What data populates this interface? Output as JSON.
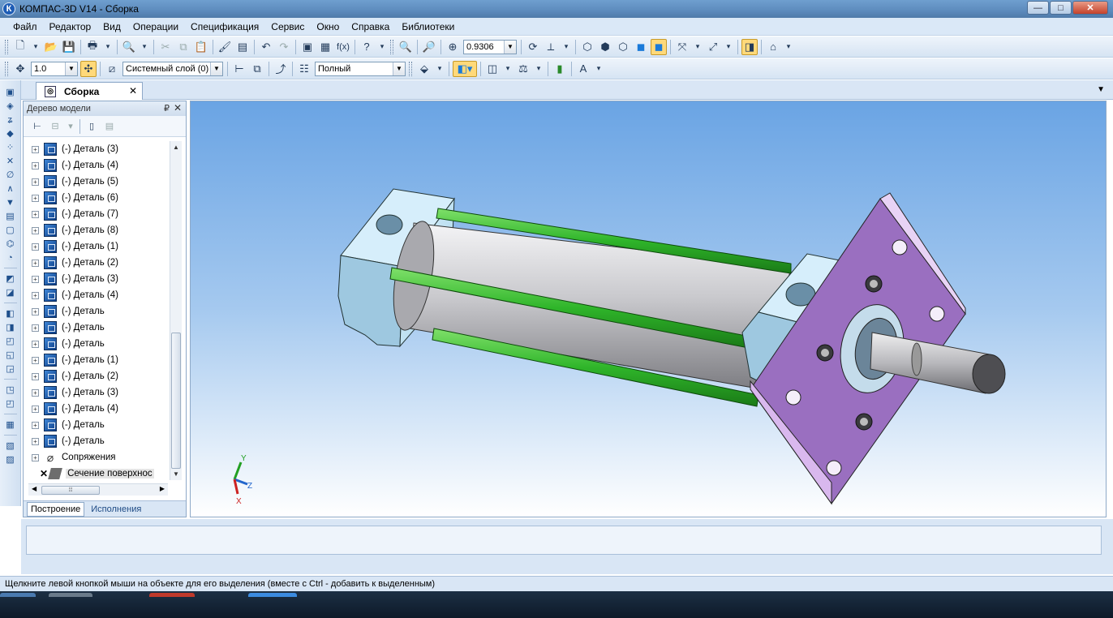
{
  "window": {
    "title": "КОМПАС-3D V14 - Сборка",
    "app_icon": "К",
    "controls": {
      "minimize": "—",
      "maximize": "□",
      "close": "✕"
    }
  },
  "menu": [
    "Файл",
    "Редактор",
    "Вид",
    "Операции",
    "Спецификация",
    "Сервис",
    "Окно",
    "Справка",
    "Библиотеки"
  ],
  "toolbar1": {
    "zoom_value": "0.9306"
  },
  "toolbar2": {
    "line_step": "1.0",
    "layer": "Системный слой (0)",
    "mode": "Полный"
  },
  "document_tab": {
    "label": "Сборка",
    "close": "✕"
  },
  "model_tree": {
    "header": "Дерево модели",
    "pin": "₽",
    "close": "✕",
    "items": [
      {
        "label": "(-) Деталь (3)",
        "type": "part"
      },
      {
        "label": "(-) Деталь (4)",
        "type": "part"
      },
      {
        "label": "(-) Деталь (5)",
        "type": "part"
      },
      {
        "label": "(-) Деталь (6)",
        "type": "part"
      },
      {
        "label": "(-) Деталь (7)",
        "type": "part"
      },
      {
        "label": "(-) Деталь (8)",
        "type": "part"
      },
      {
        "label": "(-) Деталь (1)",
        "type": "part"
      },
      {
        "label": "(-) Деталь (2)",
        "type": "part"
      },
      {
        "label": "(-) Деталь (3)",
        "type": "part"
      },
      {
        "label": "(-) Деталь (4)",
        "type": "part"
      },
      {
        "label": "(-) Деталь",
        "type": "part"
      },
      {
        "label": "(-) Деталь",
        "type": "part"
      },
      {
        "label": "(-) Деталь",
        "type": "part"
      },
      {
        "label": "(-) Деталь (1)",
        "type": "part"
      },
      {
        "label": "(-) Деталь (2)",
        "type": "part"
      },
      {
        "label": "(-) Деталь (3)",
        "type": "part"
      },
      {
        "label": "(-) Деталь (4)",
        "type": "part"
      },
      {
        "label": "(-) Деталь",
        "type": "part"
      },
      {
        "label": "(-) Деталь",
        "type": "part"
      },
      {
        "label": "Сопряжения",
        "type": "mates"
      },
      {
        "label": "Сечение поверхнос",
        "type": "section"
      }
    ],
    "tabs": [
      "Построение",
      "Исполнения"
    ]
  },
  "viewport": {
    "axes": {
      "x": "X",
      "y": "Y",
      "z": "Z"
    },
    "colors": {
      "rods": "#2fb52a",
      "flange": "#9a6fc0",
      "cap": "#bfe3f5",
      "barrel": "#c8c8cc"
    }
  },
  "status": "Щелкните левой кнопкой мыши на объекте для его выделения (вместе с Ctrl - добавить к выделенным)"
}
